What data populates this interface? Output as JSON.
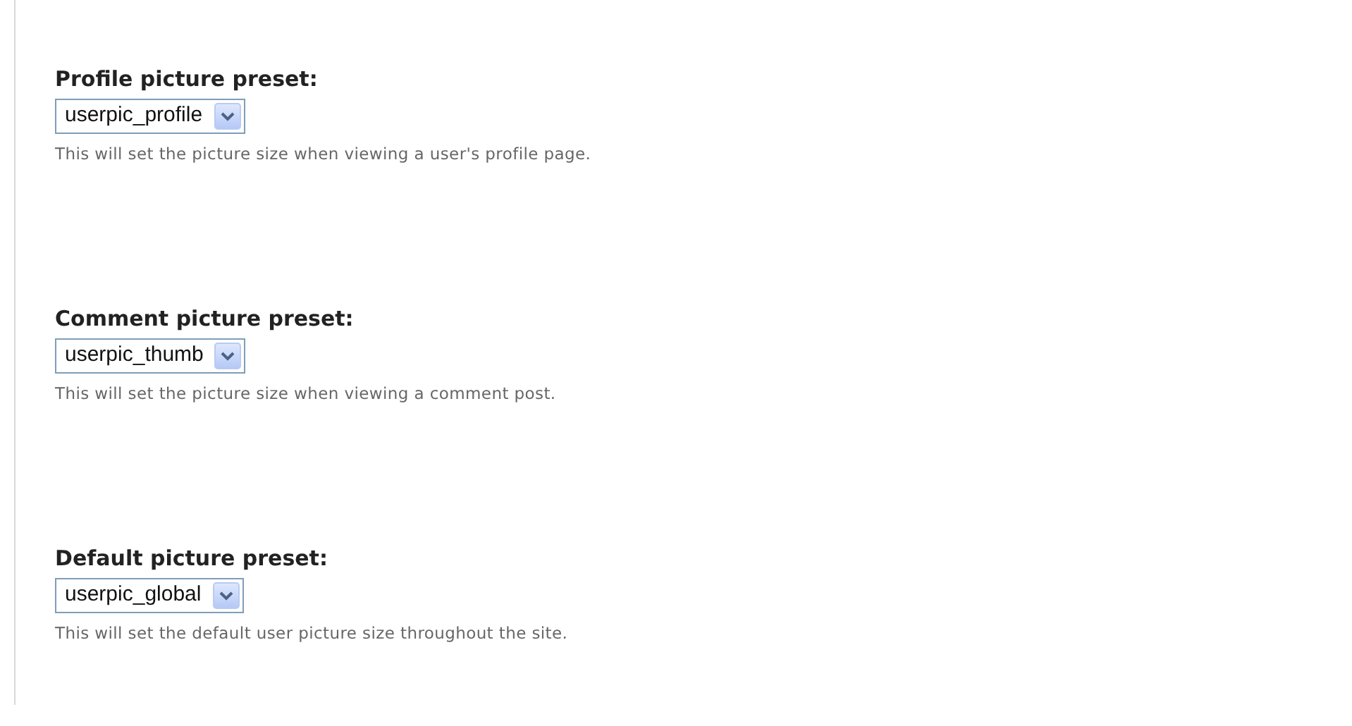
{
  "fields": [
    {
      "label": "Profile picture preset:",
      "value": "userpic_profile",
      "description": "This will set the picture size when viewing a user's profile page."
    },
    {
      "label": "Comment picture preset:",
      "value": "userpic_thumb",
      "description": "This will set the picture size when viewing a comment post."
    },
    {
      "label": "Default picture preset:",
      "value": "userpic_global",
      "description": "This will set the default user picture size throughout the site."
    }
  ]
}
